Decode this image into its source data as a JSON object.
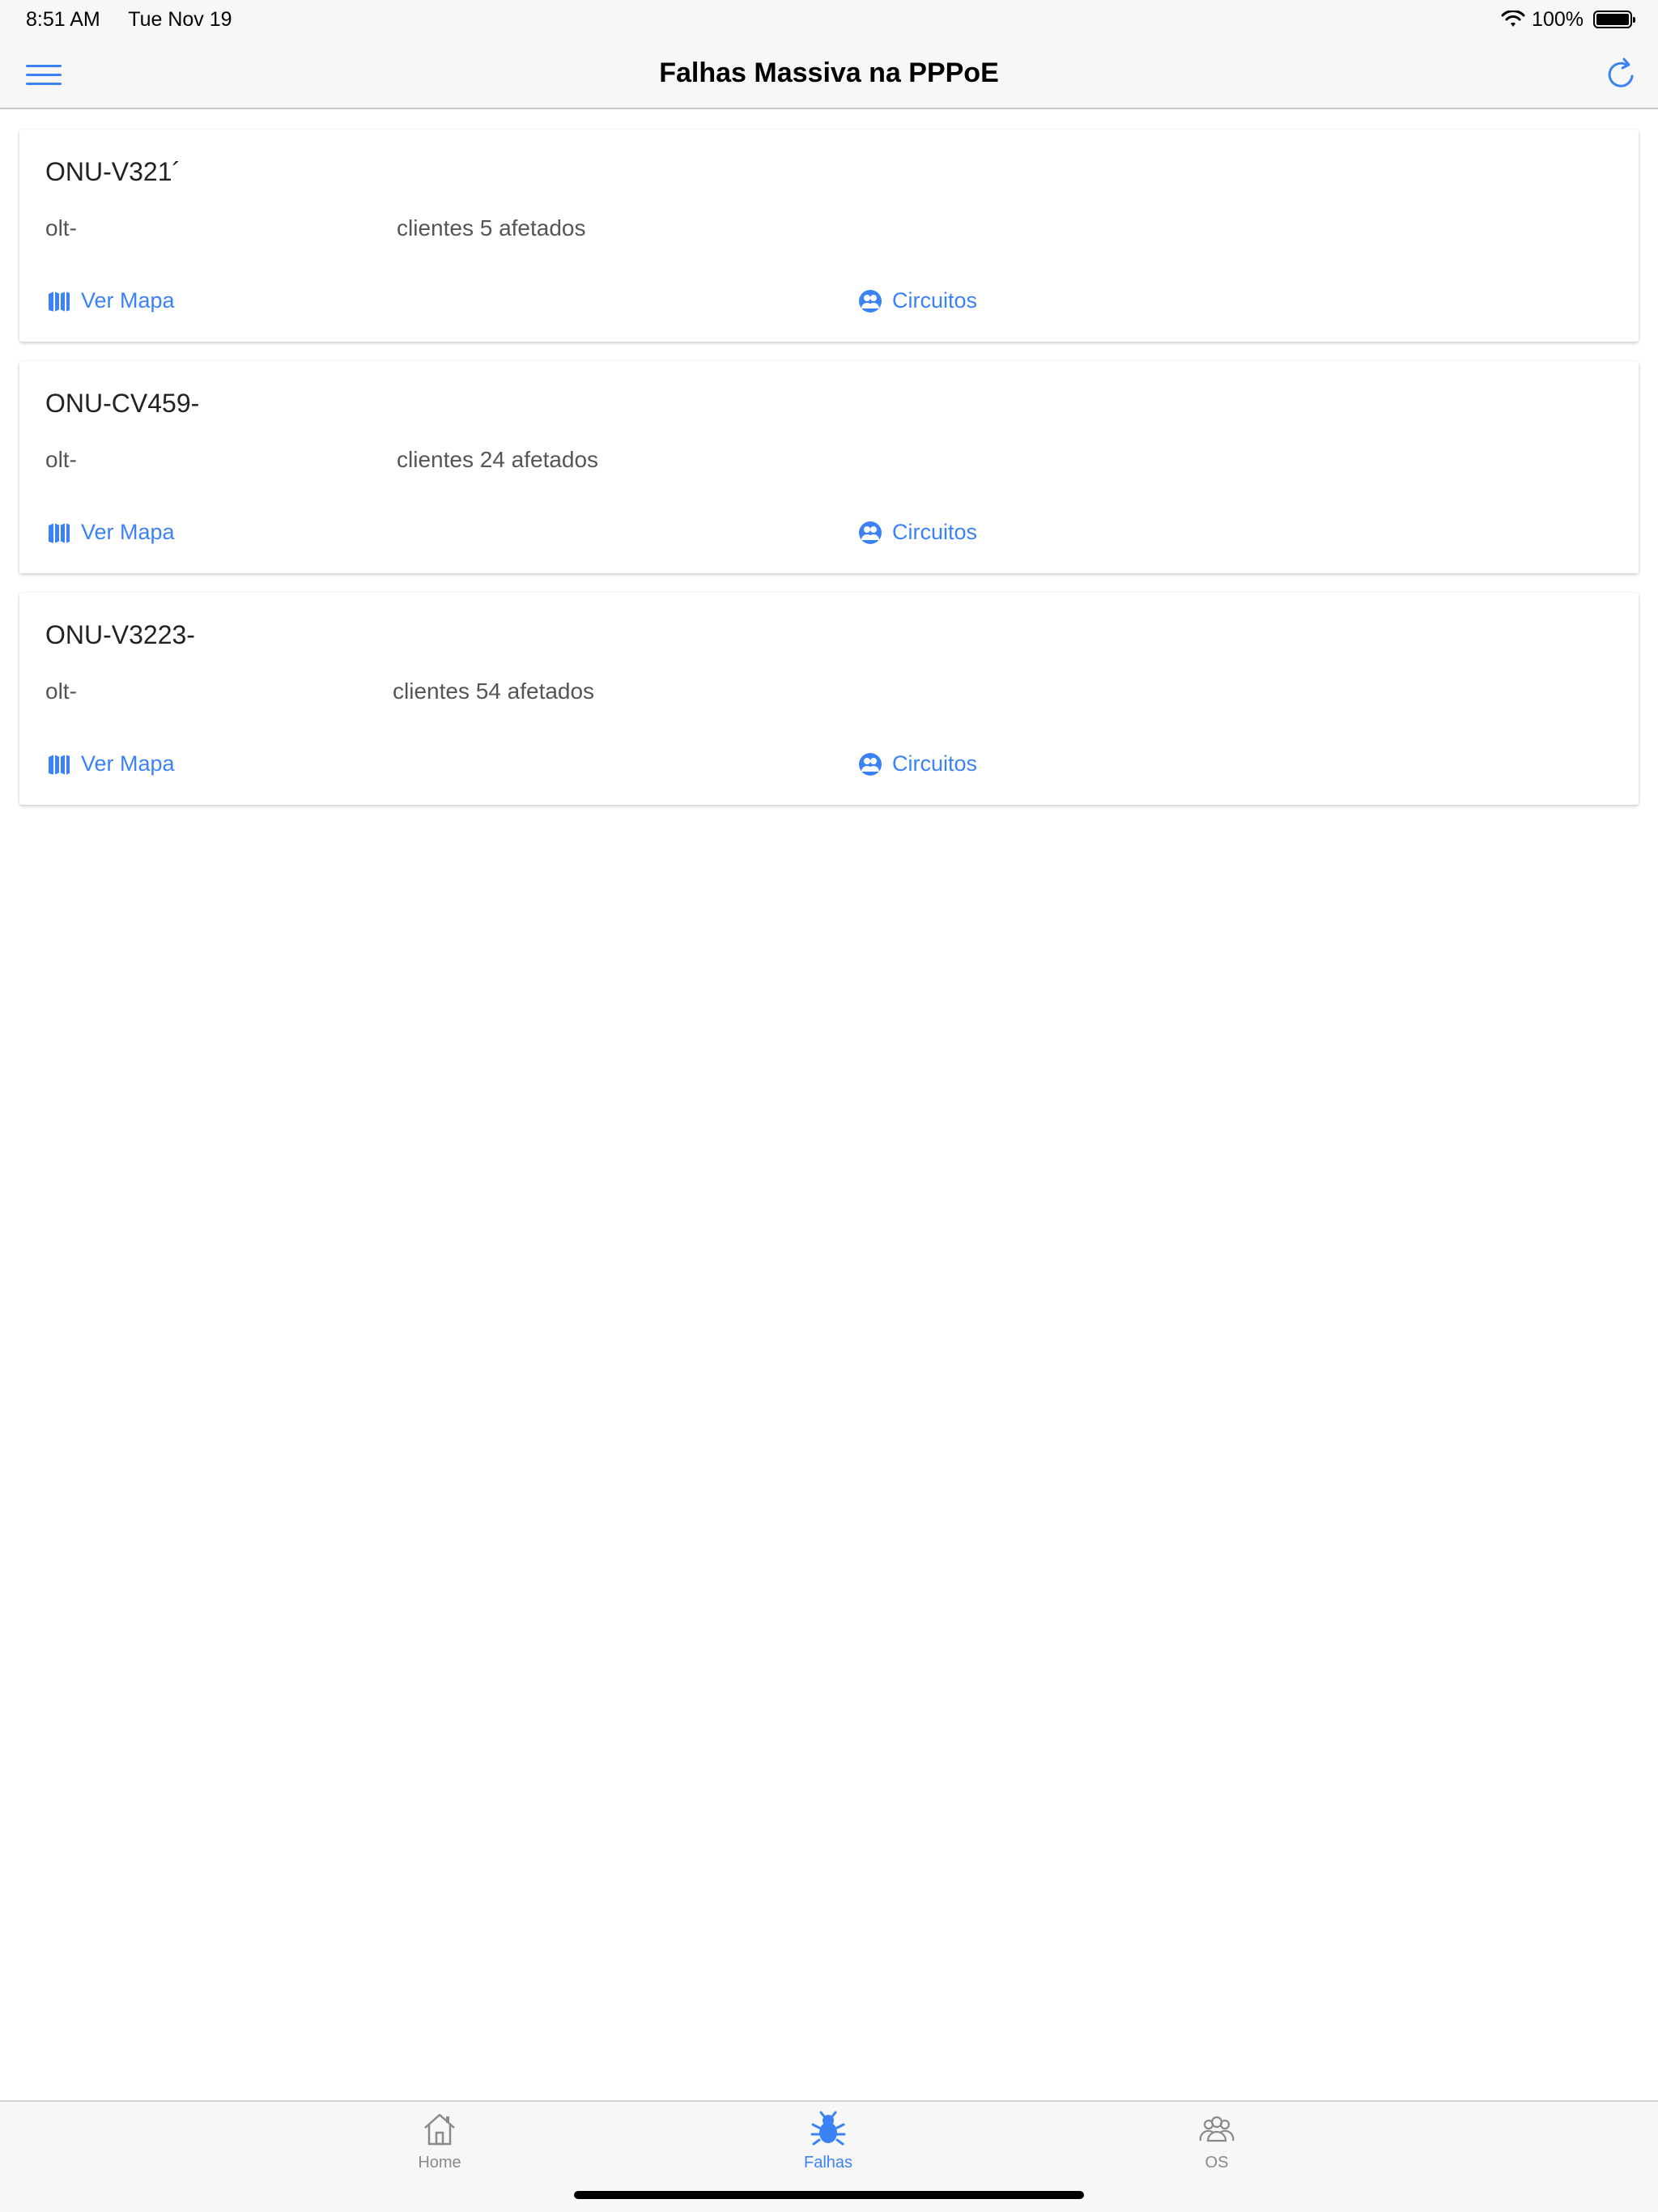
{
  "status_bar": {
    "time": "8:51 AM",
    "date": "Tue Nov 19",
    "battery": "100%",
    "battery_level": 1.0
  },
  "nav": {
    "title": "Falhas Massiva na PPPoE",
    "menu_icon": "hamburger-menu-icon",
    "refresh_icon": "refresh-icon"
  },
  "cards": [
    {
      "title": "ONU-V321´",
      "olt": "olt-",
      "clients": "clientes 5 afetados",
      "map_label": "Ver Mapa",
      "circuits_label": "Circuitos"
    },
    {
      "title": "ONU-CV459-",
      "olt": "olt-",
      "clients": "clientes 24 afetados",
      "map_label": "Ver Mapa",
      "circuits_label": "Circuitos"
    },
    {
      "title": "ONU-V3223-",
      "olt": "olt-",
      "clients": "clientes 54 afetados",
      "map_label": "Ver Mapa",
      "circuits_label": "Circuitos"
    }
  ],
  "tabs": [
    {
      "label": "Home",
      "icon": "house-icon",
      "active": false
    },
    {
      "label": "Falhas",
      "icon": "bug-icon",
      "active": true
    },
    {
      "label": "OS",
      "icon": "group-icon",
      "active": false
    }
  ],
  "colors": {
    "accent": "#3b82f6",
    "inactive": "#8a8a8a",
    "bar_background": "#f7f7f7"
  }
}
